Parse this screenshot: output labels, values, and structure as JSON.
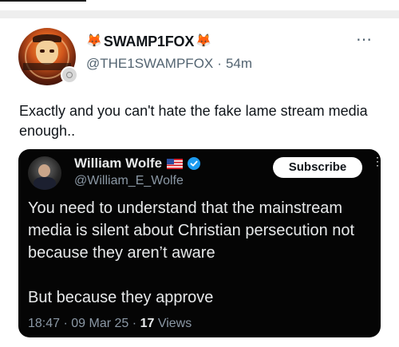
{
  "post": {
    "display_name": "SWAMP1FOX",
    "name_emoji_left": "🦊",
    "name_emoji_right": "🦊",
    "handle": "@THE1SWAMPFOX",
    "separator": "·",
    "time": "54m",
    "more_icon": "⋯",
    "text": "Exactly and you can't hate the fake lame stream media enough.."
  },
  "quoted": {
    "display_name": "William Wolfe",
    "handle": "@William_E_Wolfe",
    "subscribe_label": "Subscribe",
    "more_icon": "⋮",
    "line1": "You need to understand that the mainstream media is silent about Christian persecution not because they aren’t aware",
    "line2": "But because they approve",
    "time": "18:47",
    "separator": "·",
    "date": "09 Mar 25",
    "separator2": "·",
    "views_count": "17",
    "views_label": "Views"
  },
  "colors": {
    "accent_blue": "#1d9bf0",
    "text_primary": "#0f1419",
    "text_secondary": "#536471",
    "embed_bg": "#050505"
  }
}
